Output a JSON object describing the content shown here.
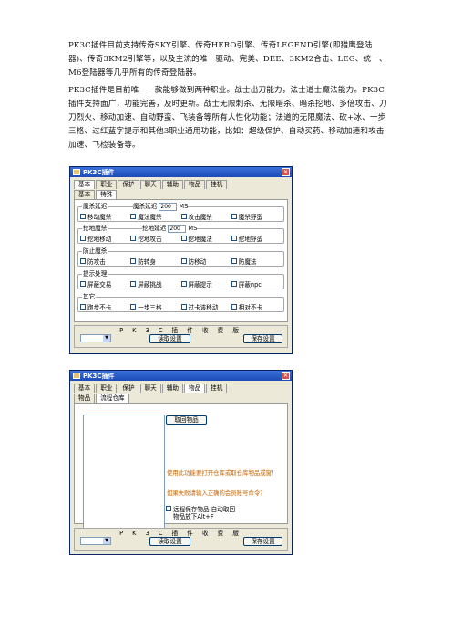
{
  "paragraphs": {
    "p1": "PK3C插件目前支持传奇SKY引擎、传奇HERO引擎、传奇LEGEND引擎(即猎鹰登陆器)、传奇3KM2引擎等，以及主流的唯一驱动、完美、DEE、3KM2合击、LEG、统一、M6登陆器等几乎所有的传奇登陆器。",
    "p2": "PK3C插件是目前唯一一款能够做到两种职业。战士出刀能力，法士道士魔法能力。PK3C插件支持面广，功能完善，及时更新。战士无限刺杀、无限暗杀、暗杀挖地、多倍攻击、刀刀烈火、移动加速、自动野蛮、飞装备等所有人性化功能；法道的无限魔法、砍+冰、一步三格、过红蓝字提示和其他3职业通用功能，比如：超级保护、自动买药、移动加速和攻击加速、飞检装备等。"
  },
  "window1": {
    "title": "PK3C插件",
    "tabs_row1": [
      "基本",
      "职业",
      "保护",
      "聊天",
      "辅助",
      "物品",
      "挂机"
    ],
    "tabs_row2": [
      "基本",
      "特殊"
    ],
    "groups": [
      {
        "title": "魔杀延迟",
        "extra_label": "魔杀延迟",
        "extra_value": "200",
        "extra_unit": "MS",
        "items": [
          "移动魔杀",
          "魔法魔杀",
          "攻击魔杀",
          "魔杀野蛮"
        ]
      },
      {
        "title": "挖地魔杀",
        "extra_label": "挖地延迟",
        "extra_value": "200",
        "extra_unit": "MS",
        "items": [
          "挖地移动",
          "挖地攻击",
          "挖地魔法",
          "挖地野蛮"
        ]
      },
      {
        "title": "防止魔杀",
        "items": [
          "防攻击",
          "防转身",
          "防移动",
          "防魔法"
        ]
      },
      {
        "title": "提示处理",
        "items": [
          "屏蔽交易",
          "屏蔽挑战",
          "屏蔽提示",
          "屏蔽npc"
        ]
      },
      {
        "title": "其它",
        "items": [
          "跑步不卡",
          "一步三格",
          "过卡该移动",
          "相对不卡"
        ]
      }
    ],
    "footer_title": "P K 3 C 插 件 收 费 版",
    "read_button": "读取设置",
    "save_button": "保存设置"
  },
  "window2": {
    "title": "PK3C插件",
    "tabs_row1": [
      "基本",
      "职业",
      "保护",
      "聊天",
      "辅助",
      "物品",
      "挂机"
    ],
    "tabs_row2": [
      "物品",
      "流程仓库"
    ],
    "get_items_button": "取回物品",
    "tip1": "使用此功能要打开仓库或取仓库物品或窗！",
    "tip2": "如果失败请输入正确的会员账号命令？",
    "check1": "远程保存物品 自动取回",
    "check2": "物品放下Alt+F",
    "footer_title": "P K 3 C 插 件 收 费 版",
    "read_button": "读取设置",
    "save_button": "保存设置"
  }
}
